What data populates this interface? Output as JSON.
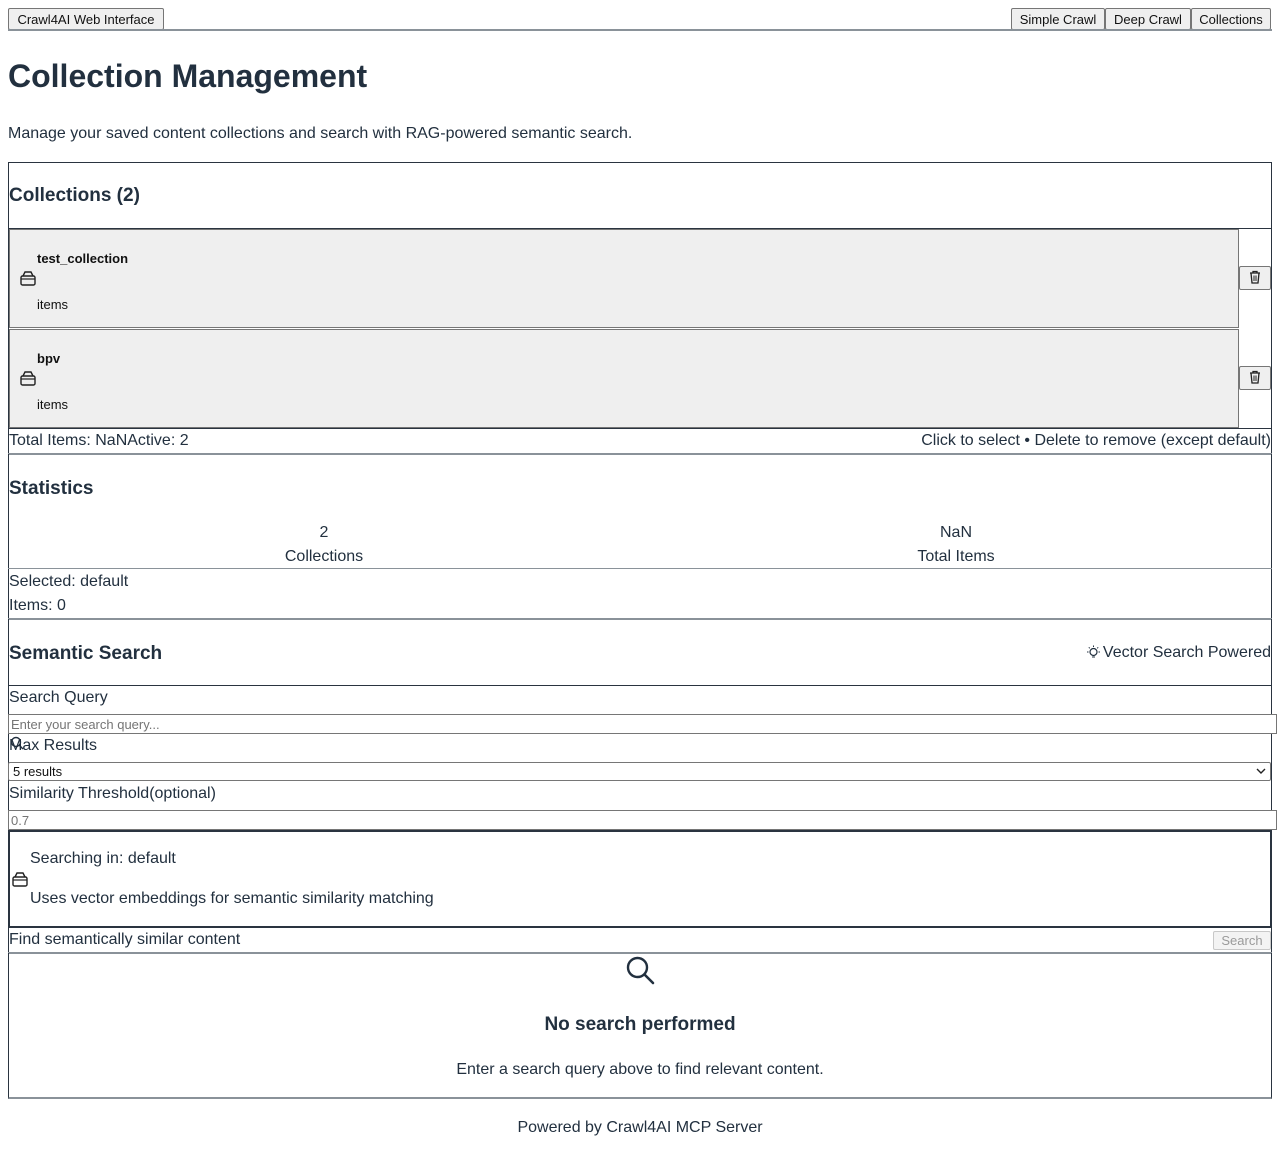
{
  "nav": {
    "brand": "Crawl4AI Web Interface",
    "links": [
      "Simple Crawl",
      "Deep Crawl",
      "Collections"
    ]
  },
  "page": {
    "title": "Collection Management",
    "subtitle": "Manage your saved content collections and search with RAG-powered semantic search."
  },
  "collections": {
    "heading": "Collections (2)",
    "items": [
      {
        "name": "test_collection",
        "count_label": "items"
      },
      {
        "name": "bpv",
        "count_label": "items"
      }
    ],
    "footer_left": "Total Items: NaNActive: 2",
    "footer_right": "Click to select • Delete to remove (except default)"
  },
  "statistics": {
    "heading": "Statistics",
    "stats": [
      {
        "value": "2",
        "label": "Collections"
      },
      {
        "value": "NaN",
        "label": "Total Items"
      }
    ],
    "selected": "Selected: default",
    "items": "Items: 0"
  },
  "search": {
    "heading": "Semantic Search",
    "badge": "Vector Search Powered",
    "query_label": "Search Query",
    "query_placeholder": "Enter your search query...",
    "max_label": "Max Results",
    "max_value": "5 results",
    "threshold_label": "Similarity Threshold(optional)",
    "threshold_placeholder": "0.7",
    "info_line1": "Searching in: default",
    "info_line2": "Uses vector embeddings for semantic similarity matching",
    "hint": "Find semantically similar content",
    "button": "Search"
  },
  "empty": {
    "title": "No search performed",
    "text": "Enter a search query above to find relevant content."
  },
  "footer": "Powered by Crawl4AI MCP Server",
  "colors": {
    "text": "#22303f",
    "card_bg": "#efefef",
    "border": "#2a3440"
  }
}
